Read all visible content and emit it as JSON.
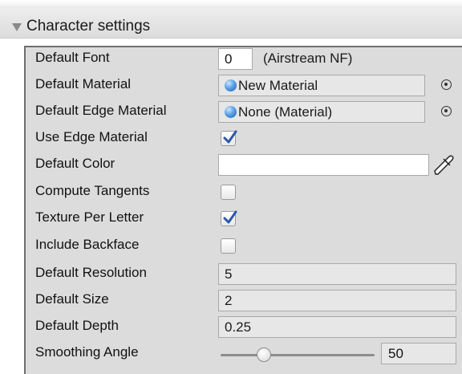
{
  "section": {
    "title": "Character settings"
  },
  "fields": {
    "default_font": {
      "label": "Default Font",
      "index": "0",
      "name": "(Airstream NF)"
    },
    "default_material": {
      "label": "Default Material",
      "value": "New Material"
    },
    "default_edge_material": {
      "label": "Default Edge Material",
      "value": "None (Material)"
    },
    "use_edge_material": {
      "label": "Use Edge Material",
      "checked": true
    },
    "default_color": {
      "label": "Default Color",
      "value": "#ffffff"
    },
    "compute_tangents": {
      "label": "Compute Tangents",
      "checked": false
    },
    "texture_per_letter": {
      "label": "Texture Per Letter",
      "checked": true
    },
    "include_backface": {
      "label": "Include Backface",
      "checked": false
    },
    "default_resolution": {
      "label": "Default Resolution",
      "value": "5"
    },
    "default_size": {
      "label": "Default Size",
      "value": "2"
    },
    "default_depth": {
      "label": "Default Depth",
      "value": "0.25"
    },
    "smoothing_angle": {
      "label": "Smoothing Angle",
      "value": "50",
      "fraction": 0.28
    }
  },
  "colors": {
    "checkmark": "#2b5aa8",
    "panel_bg": "#dcdcdc"
  },
  "icons": {
    "foldout": "triangle-down-icon",
    "material": "sphere-icon",
    "object_picker": "object-picker-icon",
    "color_picker": "eyedropper-icon",
    "check": "checkmark-icon"
  }
}
